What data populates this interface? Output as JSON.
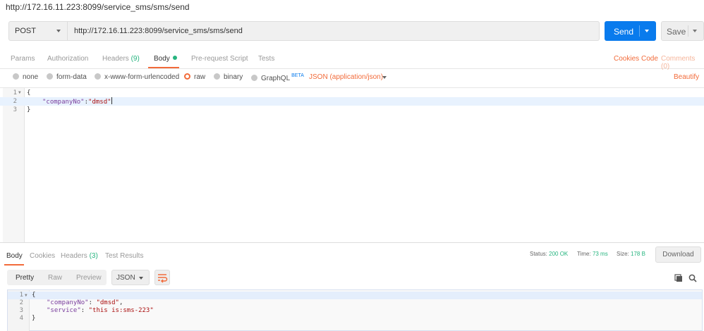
{
  "request": {
    "title": "http://172.16.11.223:8099/service_sms/sms/send",
    "method": "POST",
    "url": "http://172.16.11.223:8099/service_sms/sms/send",
    "send_label": "Send",
    "save_label": "Save"
  },
  "request_tabs": {
    "params": "Params",
    "authorization": "Authorization",
    "headers": "Headers",
    "headers_count": "(9)",
    "body": "Body",
    "prerequest": "Pre-request Script",
    "tests": "Tests",
    "cookies": "Cookies",
    "code": "Code",
    "comments": "Comments (0)"
  },
  "body_options": {
    "none": "none",
    "form_data": "form-data",
    "urlencoded": "x-www-form-urlencoded",
    "raw": "raw",
    "binary": "binary",
    "graphql": "GraphQL",
    "beta": "BETA",
    "content_type": "JSON (application/json)",
    "beautify": "Beautify"
  },
  "request_editor": {
    "lines": [
      {
        "num": "1",
        "open": "{"
      },
      {
        "num": "2",
        "key": "\"companyNo\"",
        "colon": ":",
        "value": "\"dmsd\""
      },
      {
        "num": "3",
        "close": "}"
      }
    ]
  },
  "response_tabs": {
    "body": "Body",
    "cookies": "Cookies",
    "headers": "Headers",
    "headers_count": "(3)",
    "test_results": "Test Results"
  },
  "response_status": {
    "status_label": "Status:",
    "status_value": "200 OK",
    "time_label": "Time:",
    "time_value": "73 ms",
    "size_label": "Size:",
    "size_value": "178 B",
    "download": "Download"
  },
  "response_toolbar": {
    "pretty": "Pretty",
    "raw": "Raw",
    "preview": "Preview",
    "format": "JSON"
  },
  "response_editor": {
    "lines": [
      {
        "num": "1",
        "open": "{"
      },
      {
        "num": "2",
        "key": "\"companyNo\"",
        "colon": ": ",
        "value": "\"dmsd\"",
        "comma": ","
      },
      {
        "num": "3",
        "key": "\"service\"",
        "colon": ": ",
        "value": "\"this is:sms-223\""
      },
      {
        "num": "4",
        "close": "}"
      }
    ]
  },
  "colors": {
    "accent": "#f26b3a",
    "send_blue": "#097bed",
    "success_green": "#26b47f",
    "json_key": "#7a3e9d",
    "json_string": "#a11"
  },
  "icons": [
    "dropdown-caret-icon",
    "wrap-lines-icon",
    "copy-icon",
    "search-icon",
    "fold-arrow-icon"
  ]
}
